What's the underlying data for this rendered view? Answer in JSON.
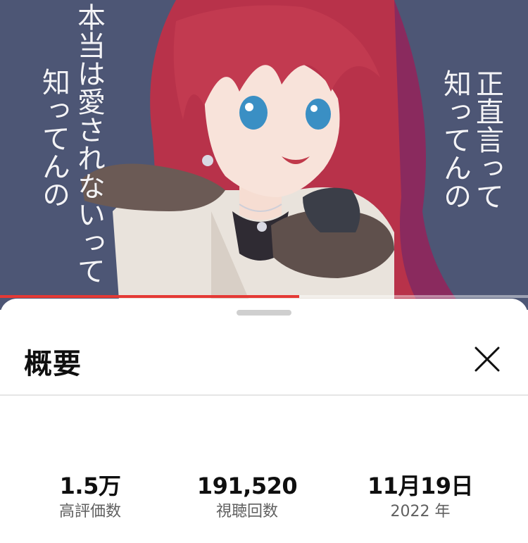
{
  "video": {
    "lyrics_left": [
      "本当は愛されないって",
      "知ってんの"
    ],
    "lyrics_right": [
      "正直言って",
      "知ってんの"
    ],
    "progress": 0.567,
    "progress_color": "#e53935",
    "background_color": "#4d5675"
  },
  "sheet": {
    "title": "概要",
    "close_icon": "close-x-icon"
  },
  "stats": [
    {
      "value": "1.5万",
      "label": "高評価数"
    },
    {
      "value": "191,520",
      "label": "視聴回数"
    },
    {
      "value": "11月19日",
      "label": "2022 年"
    }
  ]
}
